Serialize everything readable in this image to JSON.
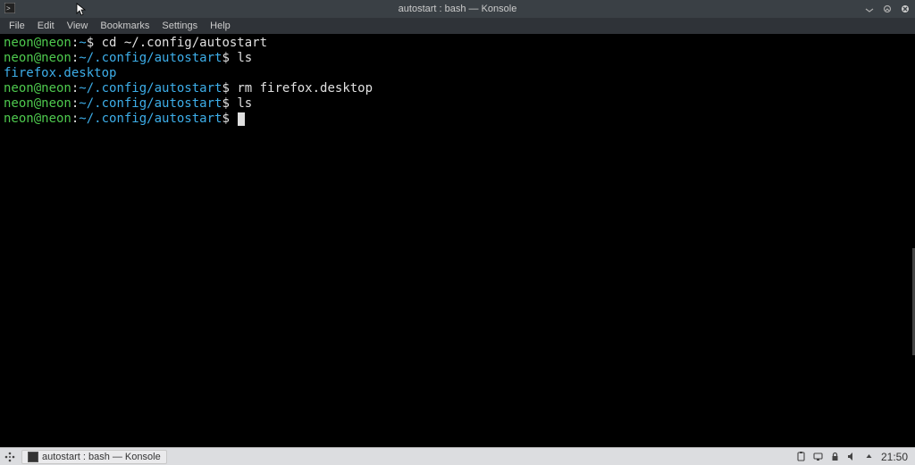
{
  "window": {
    "title": "autostart : bash — Konsole"
  },
  "menu": {
    "file": "File",
    "edit": "Edit",
    "view": "View",
    "bookmarks": "Bookmarks",
    "settings": "Settings",
    "help": "Help"
  },
  "terminal": {
    "lines": [
      {
        "user_host": "neon@neon",
        "sep": ":",
        "path": "~",
        "dollar": "$",
        "command": "cd ~/.config/autostart"
      },
      {
        "user_host": "neon@neon",
        "sep": ":",
        "path": "~/.config/autostart",
        "dollar": "$",
        "command": "ls"
      },
      {
        "output": "firefox.desktop",
        "class": "ls-output"
      },
      {
        "user_host": "neon@neon",
        "sep": ":",
        "path": "~/.config/autostart",
        "dollar": "$",
        "command": "rm firefox.desktop"
      },
      {
        "user_host": "neon@neon",
        "sep": ":",
        "path": "~/.config/autostart",
        "dollar": "$",
        "command": "ls"
      },
      {
        "user_host": "neon@neon",
        "sep": ":",
        "path": "~/.config/autostart",
        "dollar": "$",
        "command": "",
        "cursor": true
      }
    ]
  },
  "taskbar": {
    "task_label": "autostart : bash — Konsole",
    "clock": "21:50"
  }
}
